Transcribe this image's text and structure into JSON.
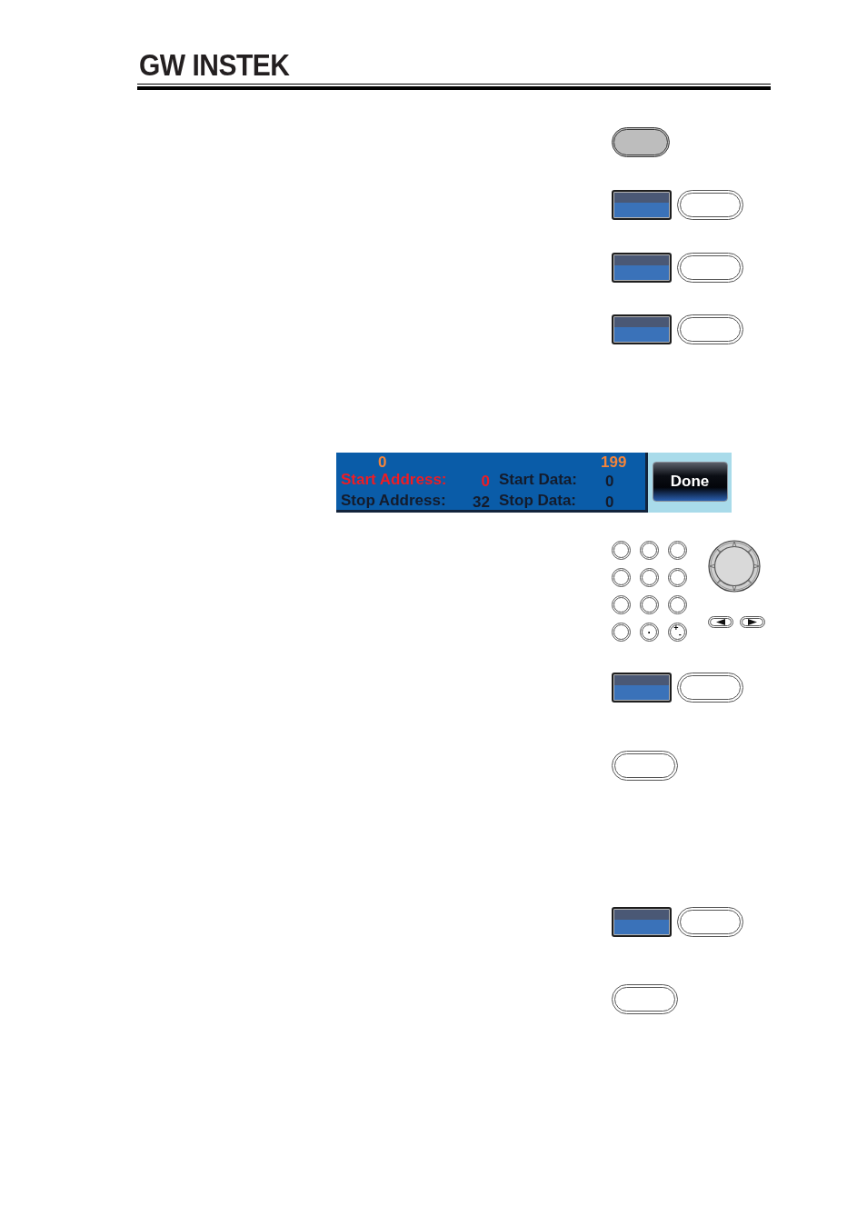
{
  "header": {
    "logo": "GW INSTEK"
  },
  "figures": [
    {
      "kind": "function_key"
    },
    {
      "kind": "softkey"
    },
    {
      "kind": "softkey"
    },
    {
      "kind": "softkey"
    },
    {
      "kind": "display",
      "limits": [
        "0",
        "199"
      ],
      "fields": [
        {
          "label": "Start Address:",
          "value": "0",
          "selected": true
        },
        {
          "label": "Start Data:",
          "value": "0",
          "selected": false
        },
        {
          "label": "Stop Address:",
          "value": "32",
          "selected": false
        },
        {
          "label": "Stop Data:",
          "value": "0",
          "selected": false
        }
      ],
      "done_button": "Done"
    },
    {
      "kind": "keypad",
      "keys": [
        {
          "kind": "blank"
        },
        {
          "kind": "blank"
        },
        {
          "kind": "blank"
        },
        {
          "kind": "blank"
        },
        {
          "kind": "blank"
        },
        {
          "kind": "blank"
        },
        {
          "kind": "blank"
        },
        {
          "kind": "blank"
        },
        {
          "kind": "blank"
        },
        {
          "kind": "blank"
        },
        {
          "kind": "labeled",
          "label": "·"
        },
        {
          "kind": "labeled",
          "label": "$^{+}$$_{-}$"
        }
      ]
    },
    {
      "kind": "softkey"
    },
    {
      "kind": "key"
    },
    {
      "kind": "softkey"
    },
    {
      "kind": "key"
    }
  ]
}
